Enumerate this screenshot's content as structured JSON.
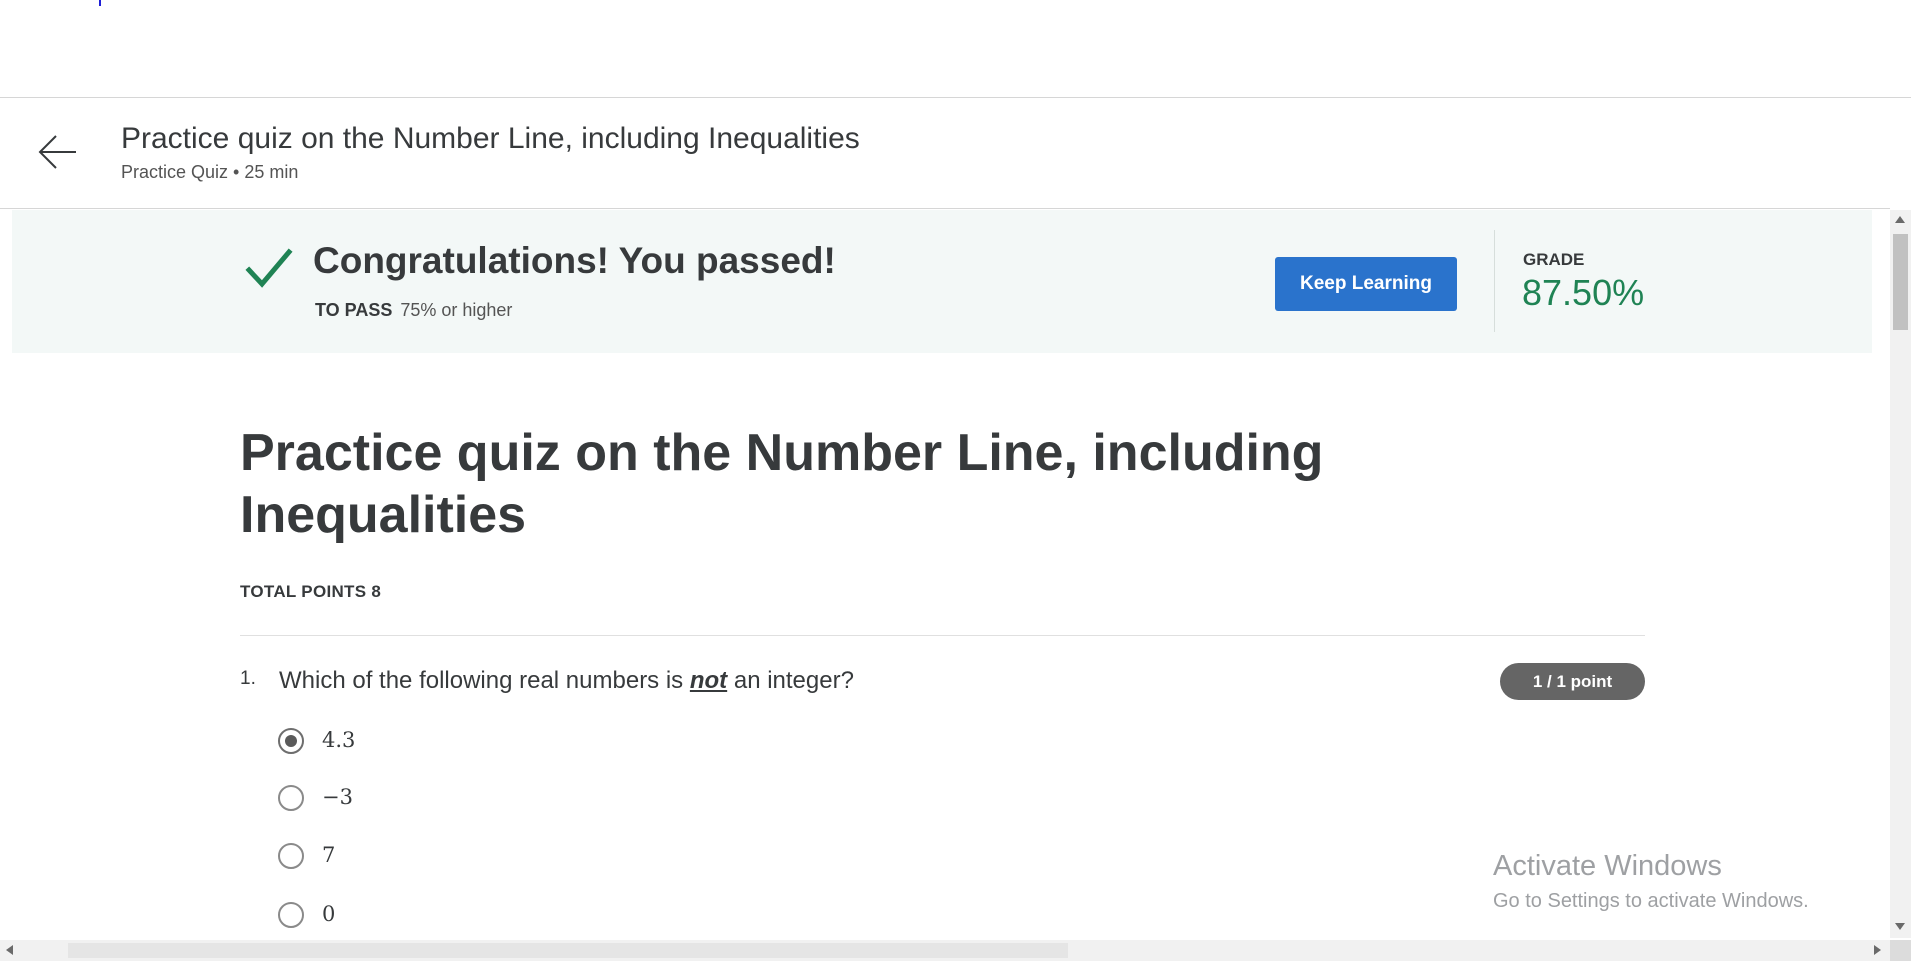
{
  "header": {
    "title": "Practice quiz on the Number Line, including Inequalities",
    "subtitle": "Practice Quiz • 25 min"
  },
  "banner": {
    "title": "Congratulations! You passed!",
    "pass_label": "TO PASS",
    "pass_value": "75% or higher",
    "button_label": "Keep Learning",
    "grade_label": "GRADE",
    "grade_value": "87.50%",
    "success_color": "#1f8354"
  },
  "quiz": {
    "title": "Practice quiz on the Number Line, including Inequalities",
    "total_points": "TOTAL POINTS 8"
  },
  "question": {
    "number": "1.",
    "text_before": "Which of the following real numbers is ",
    "text_emphasis": "not",
    "text_after": " an integer?",
    "points_badge": "1 / 1 point",
    "options": [
      {
        "label": "4.3",
        "selected": true
      },
      {
        "label": "−3",
        "selected": false
      },
      {
        "label": "7",
        "selected": false
      },
      {
        "label": "0",
        "selected": false
      }
    ]
  },
  "watermark": {
    "line1": "Activate Windows",
    "line2": "Go to Settings to activate Windows."
  },
  "icons": [
    "back-arrow-icon",
    "checkmark-icon"
  ],
  "colors": {
    "accent_button": "#2a73cc",
    "banner_background": "#f3f8f7",
    "badge_background": "#656565"
  }
}
